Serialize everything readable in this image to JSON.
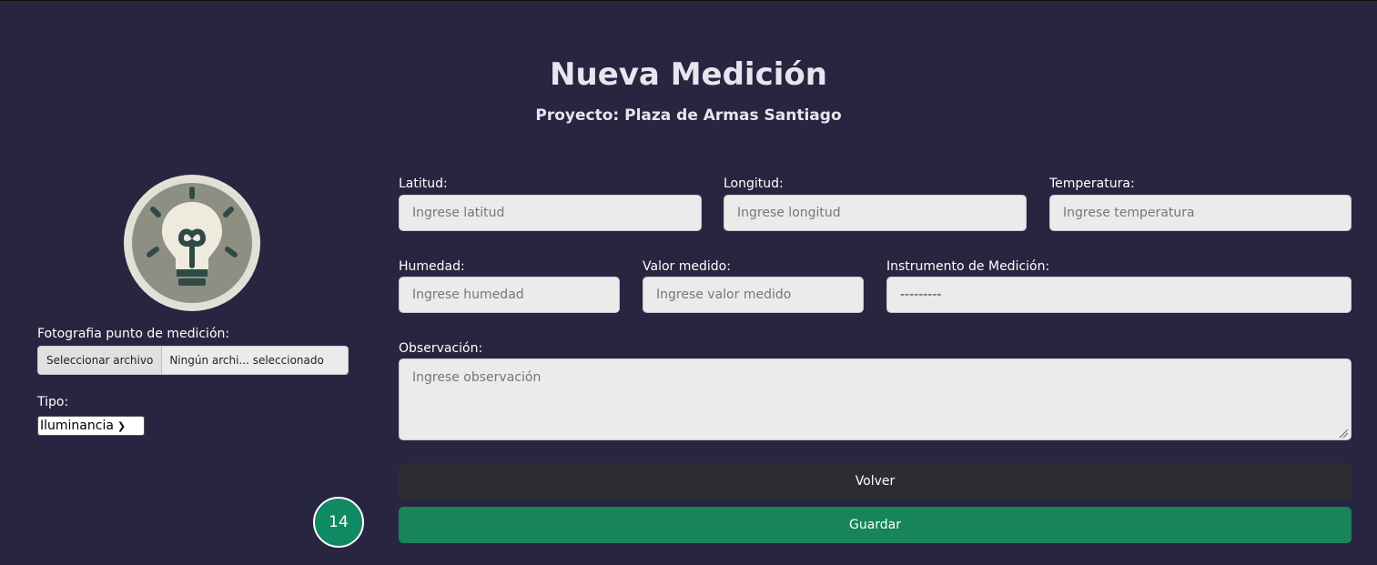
{
  "header": {
    "title": "Nueva Medición",
    "subtitle": "Proyecto: Plaza de Armas Santiago"
  },
  "image": {
    "icon": "lightbulb-icon"
  },
  "photo": {
    "label": "Fotografia punto de medición:",
    "button_label": "Seleccionar archivo",
    "file_status": "Ningún archi... seleccionado"
  },
  "tipo": {
    "label": "Tipo:",
    "selected": "Iluminancia"
  },
  "fields": {
    "latitud": {
      "label": "Latitud:",
      "placeholder": "Ingrese latitud"
    },
    "longitud": {
      "label": "Longitud:",
      "placeholder": "Ingrese longitud"
    },
    "temperatura": {
      "label": "Temperatura:",
      "placeholder": "Ingrese temperatura"
    },
    "humedad": {
      "label": "Humedad:",
      "placeholder": "Ingrese humedad"
    },
    "valor": {
      "label": "Valor medido:",
      "placeholder": "Ingrese valor medido"
    },
    "instrumento": {
      "label": "Instrumento de Medición:",
      "selected": "---------"
    },
    "observacion": {
      "label": "Observación:",
      "placeholder": "Ingrese observación"
    }
  },
  "buttons": {
    "back": "Volver",
    "save": "Guardar"
  },
  "badge": {
    "value": "14"
  },
  "colors": {
    "background": "#27253f",
    "save": "#17845a",
    "back": "#2c2d33"
  }
}
